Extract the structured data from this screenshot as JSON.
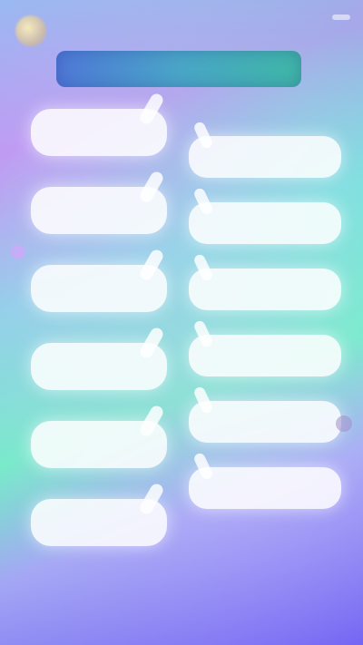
{
  "header": {
    "title": ""
  },
  "left_items": [
    {
      "label": ""
    },
    {
      "label": ""
    },
    {
      "label": ""
    },
    {
      "label": ""
    },
    {
      "label": ""
    },
    {
      "label": ""
    }
  ],
  "right_items": [
    {
      "label": ""
    },
    {
      "label": ""
    },
    {
      "label": ""
    },
    {
      "label": ""
    },
    {
      "label": ""
    },
    {
      "label": ""
    }
  ],
  "colors": {
    "accent": "#4aa6c8",
    "pill": "#ffffff"
  }
}
